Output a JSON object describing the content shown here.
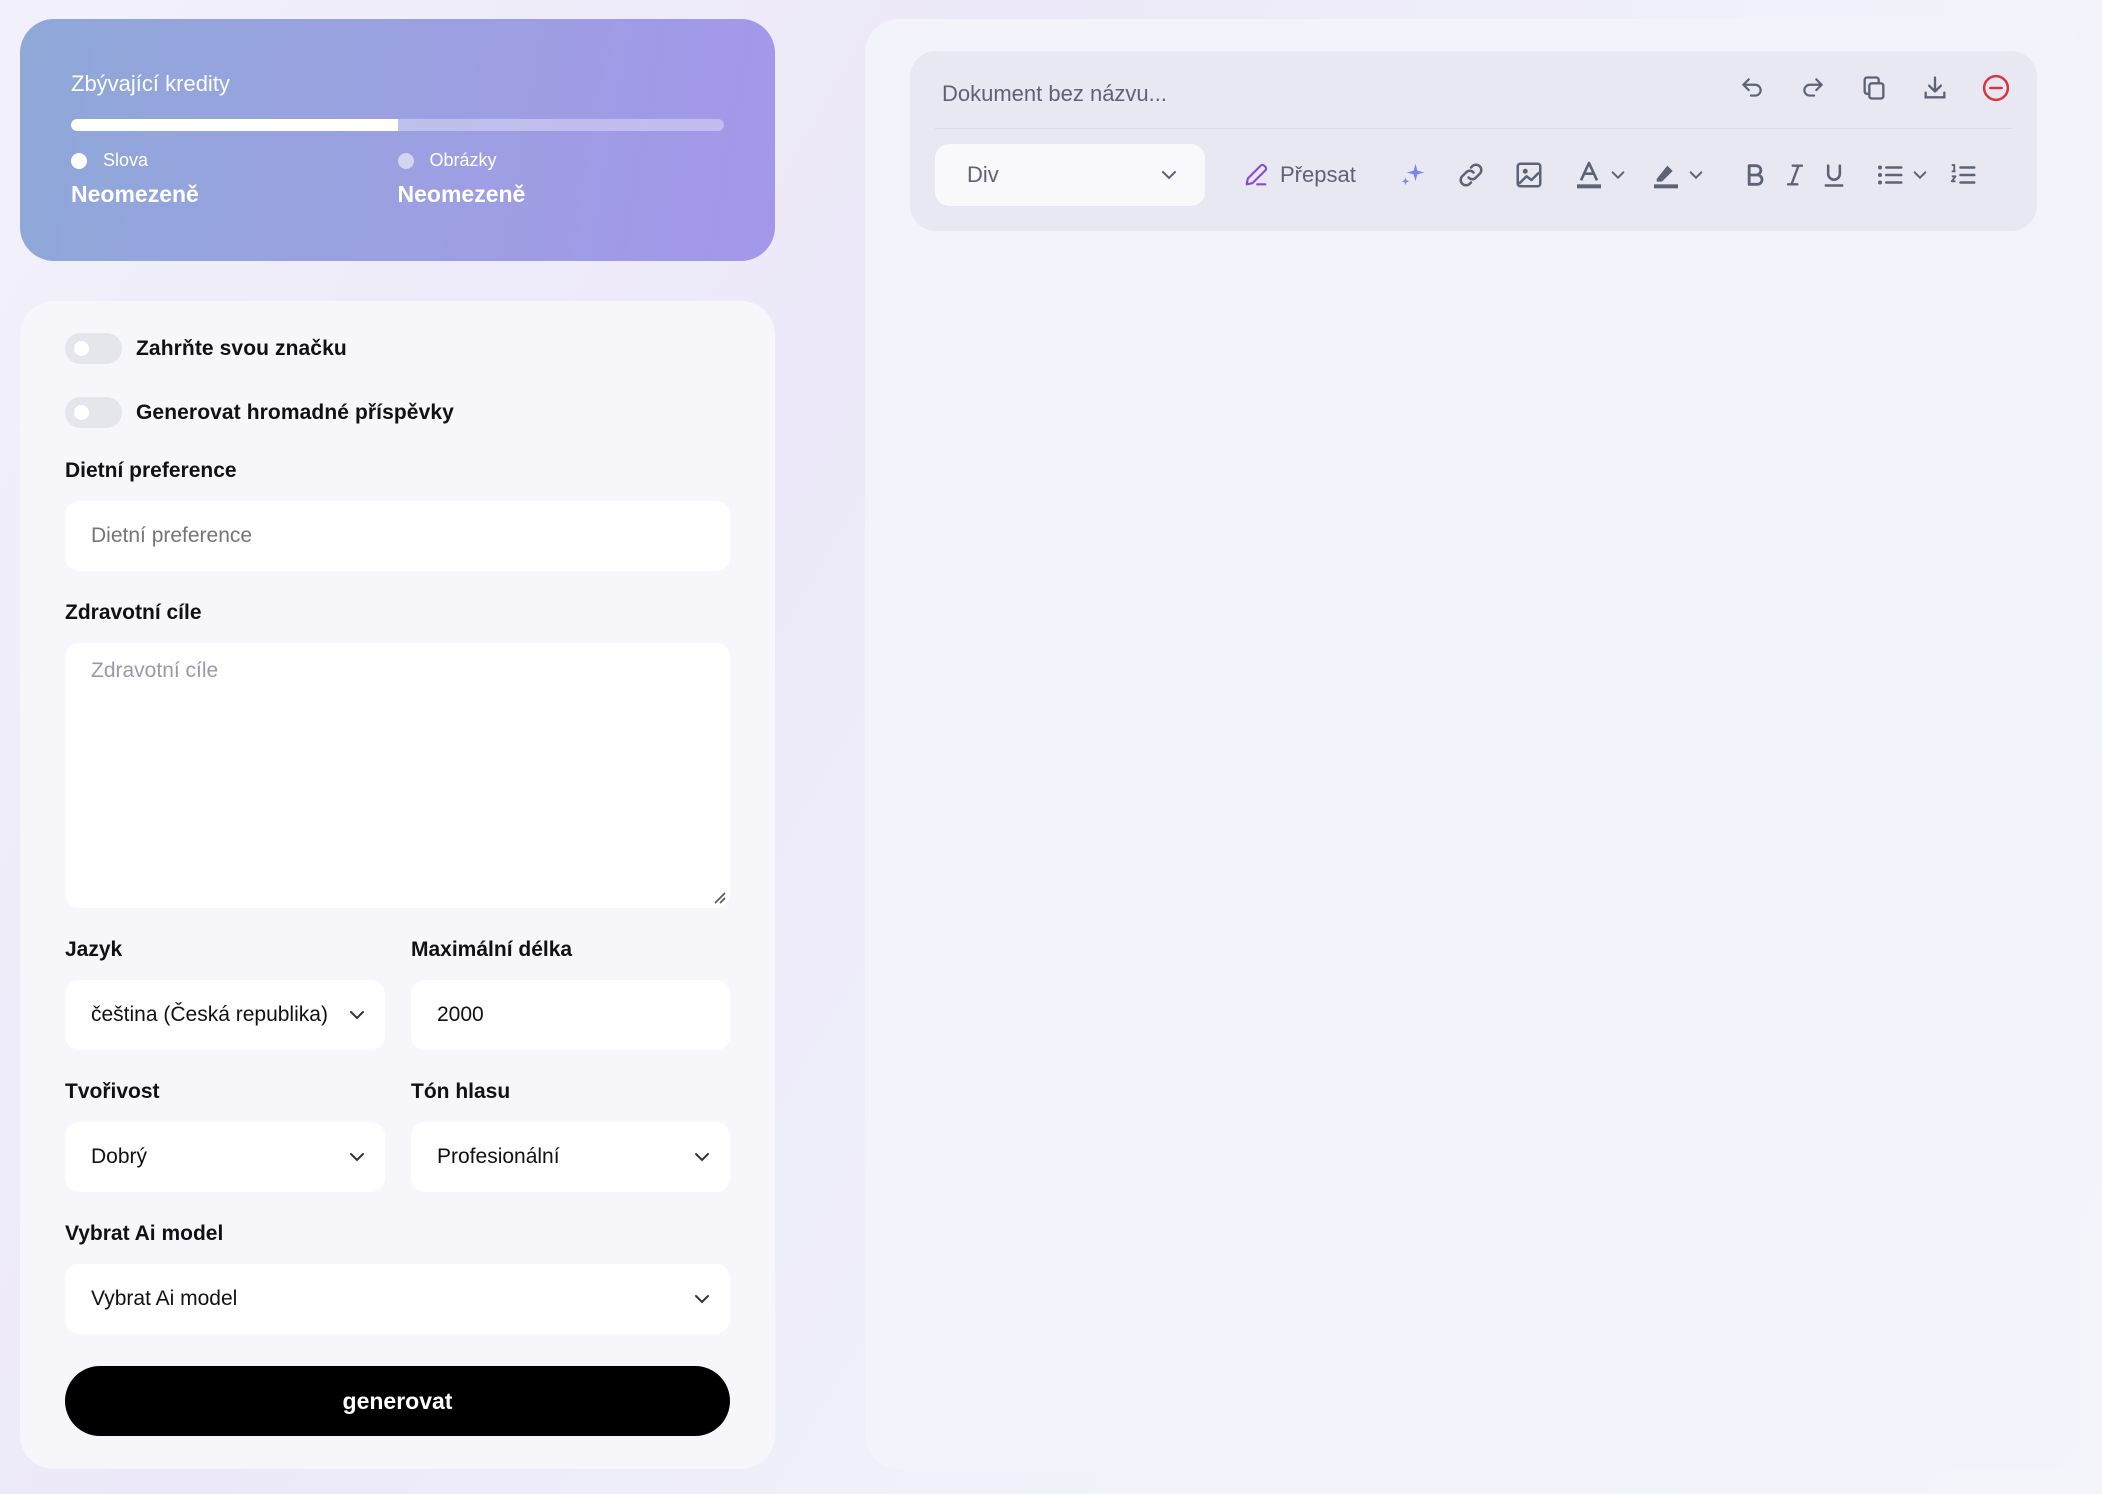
{
  "credits": {
    "title": "Zbývající kredity",
    "progress_fraction": 0.5,
    "words": {
      "label": "Slova",
      "value": "Neomezeně"
    },
    "images": {
      "label": "Obrázky",
      "value": "Neomezeně"
    }
  },
  "form": {
    "toggle_brand": "Zahrňte svou značku",
    "toggle_bulk": "Generovat hromadné příspěvky",
    "dietary": {
      "label": "Dietní preference",
      "placeholder": "Dietní preference",
      "value": ""
    },
    "health": {
      "label": "Zdravotní cíle",
      "placeholder": "Zdravotní cíle",
      "value": ""
    },
    "language": {
      "label": "Jazyk",
      "value": "čeština (Česká republika)"
    },
    "max_length": {
      "label": "Maximální délka",
      "value": "2000"
    },
    "creativity": {
      "label": "Tvořivost",
      "value": "Dobrý"
    },
    "tone": {
      "label": "Tón hlasu",
      "value": "Profesionální"
    },
    "ai_model": {
      "label": "Vybrat Ai model",
      "value": "Vybrat Ai model"
    },
    "generate_label": "generovat"
  },
  "editor": {
    "doc_title_placeholder": "Dokument bez názvu...",
    "block_type": "Div",
    "rewrite_label": "Přepsat",
    "icons": [
      "undo-icon",
      "redo-icon",
      "copy-icon",
      "download-icon",
      "delete-icon",
      "pencil-icon",
      "sparkle-icon",
      "link-icon",
      "image-icon",
      "text-color-icon",
      "highlight-icon",
      "bold-icon",
      "italic-icon",
      "underline-icon",
      "bullet-list-icon",
      "numbered-list-icon"
    ],
    "colors": {
      "delete": "#d9363e",
      "rewrite": "#8a47d6",
      "sparkle": "#7b86e8",
      "icon": "#5d6376"
    }
  }
}
